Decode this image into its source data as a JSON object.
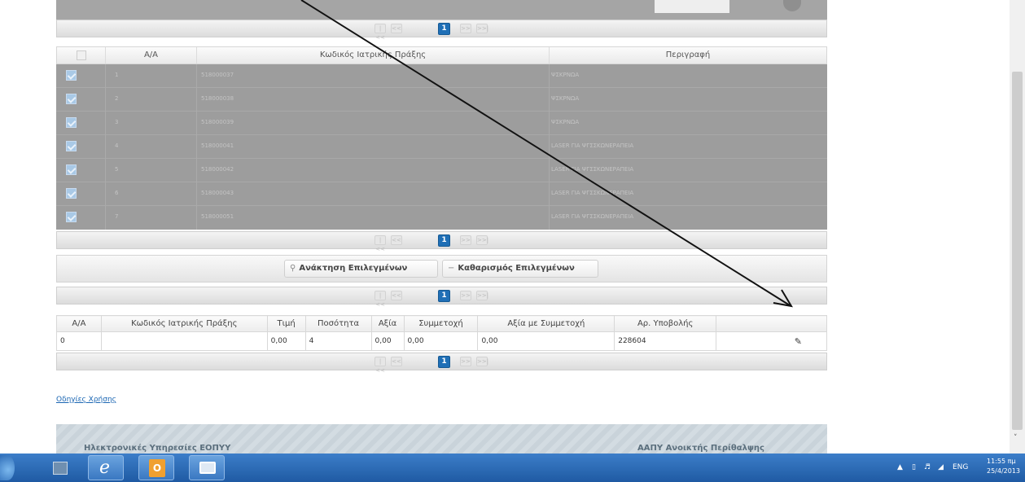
{
  "pager": {
    "current_page": "1",
    "first": "|<<",
    "prev": "<<",
    "next": ">>",
    "last": ">>|"
  },
  "upper_table": {
    "headers": {
      "aa": "Α/Α",
      "code": "Κωδικός Ιατρικής Πράξης",
      "description": "Περιγραφή"
    },
    "rows": [
      {
        "aa": "1",
        "code": "518000037",
        "description": "ΨΣΚΡΝΩΑ"
      },
      {
        "aa": "2",
        "code": "518000038",
        "description": "ΨΣΚΡΝΩΑ"
      },
      {
        "aa": "3",
        "code": "518000039",
        "description": "ΨΣΚΡΝΩΑ"
      },
      {
        "aa": "4",
        "code": "518000041",
        "description": "LASER ΓΙΑ ΨΓΣΣΚΩΝΕΡΑΠΕΙΑ"
      },
      {
        "aa": "5",
        "code": "518000042",
        "description": "LASER ΓΙΑ ΨΓΣΣΚΩΝΕΡΑΠΕΙΑ"
      },
      {
        "aa": "6",
        "code": "518000043",
        "description": "LASER ΓΙΑ ΨΓΣΣΚΩΝΕΡΑΠΕΙΑ"
      },
      {
        "aa": "7",
        "code": "518000051",
        "description": "LASER ΓΙΑ ΨΓΣΣΚΩΝΕΡΑΠΕΙΑ"
      }
    ]
  },
  "actions": {
    "retrieve_label": "Ανάκτηση Επιλεγμένων",
    "clear_label": "Καθαρισμός Επιλεγμένων"
  },
  "lower_table": {
    "headers": {
      "aa": "Α/Α",
      "code": "Κωδικός Ιατρικής Πράξης",
      "price": "Τιμή",
      "quantity": "Ποσότητα",
      "value": "Αξία",
      "copay": "Συμμετοχή",
      "value_with_copay": "Αξία με Συμμετοχή",
      "submission_no": "Αρ. Υποβολής"
    },
    "rows": [
      {
        "aa": "0",
        "code": "",
        "price": "0,00",
        "quantity": "4",
        "value": "0,00",
        "copay": "0,00",
        "value_with_copay": "0,00",
        "submission_no": "228604"
      }
    ]
  },
  "help_link": "Οδηγίες Χρήσης",
  "footer": {
    "left": "Ηλεκτρονικές Υπηρεσίες ΕΟΠΥΥ",
    "right": "ΑΑΠΥ Ανοικτής Περίθαλψης"
  },
  "taskbar": {
    "language": "ENG",
    "time": "11:55 πμ",
    "date": "25/4/2013"
  },
  "colors": {
    "accent": "#1f6fb6",
    "taskbar": "#2b6cb8",
    "overlay_grey": "#9d9d9d"
  }
}
